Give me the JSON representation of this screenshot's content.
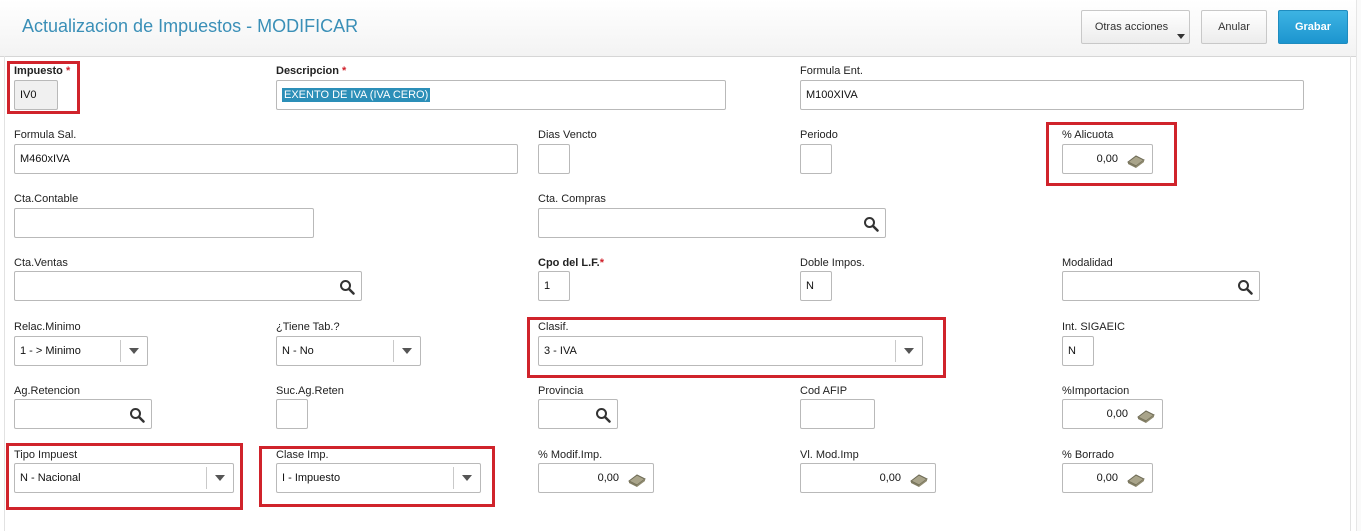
{
  "header": {
    "title": "Actualizacion de Impuestos - MODIFICAR",
    "actions": {
      "otras": "Otras acciones",
      "anular": "Anular",
      "grabar": "Grabar"
    }
  },
  "required_mark": "*",
  "fields": {
    "impuesto": {
      "label": "Impuesto",
      "value": "IV0"
    },
    "descripcion": {
      "label": "Descripcion",
      "value": "EXENTO DE IVA (IVA CERO)"
    },
    "formula_ent": {
      "label": "Formula Ent.",
      "value": "M100XIVA"
    },
    "formula_sal": {
      "label": "Formula Sal.",
      "value": "M460xIVA"
    },
    "dias_vencto": {
      "label": "Dias Vencto",
      "value": ""
    },
    "periodo": {
      "label": "Periodo",
      "value": ""
    },
    "alicuota": {
      "label": "% Alicuota",
      "value": "0,00"
    },
    "cta_contable": {
      "label": "Cta.Contable",
      "value": ""
    },
    "cta_compras": {
      "label": "Cta. Compras",
      "value": ""
    },
    "cta_ventas": {
      "label": "Cta.Ventas",
      "value": ""
    },
    "cpo_lf": {
      "label": "Cpo del L.F.",
      "value": "1"
    },
    "doble_impos": {
      "label": "Doble Impos.",
      "value": "N"
    },
    "modalidad": {
      "label": "Modalidad",
      "value": ""
    },
    "relac_minimo": {
      "label": "Relac.Minimo",
      "value": "1 -  > Minimo"
    },
    "tiene_tab": {
      "label": "¿Tiene Tab.?",
      "value": "N -  No"
    },
    "clasif": {
      "label": "Clasif.",
      "value": "3 - IVA"
    },
    "int_sigaeic": {
      "label": "Int. SIGAEIC",
      "value": "N"
    },
    "ag_retencion": {
      "label": "Ag.Retencion",
      "value": ""
    },
    "suc_ag_reten": {
      "label": "Suc.Ag.Reten",
      "value": ""
    },
    "provincia": {
      "label": "Provincia",
      "value": ""
    },
    "cod_afip": {
      "label": "Cod AFIP",
      "value": ""
    },
    "importacion": {
      "label": "%Importacion",
      "value": "0,00"
    },
    "tipo_impuest": {
      "label": "Tipo Impuest",
      "value": "N - Nacional"
    },
    "clase_imp": {
      "label": "Clase Imp.",
      "value": "I - Impuesto"
    },
    "modif_imp": {
      "label": "% Modif.Imp.",
      "value": "0,00"
    },
    "vl_mod_imp": {
      "label": "Vl. Mod.Imp",
      "value": "0,00"
    },
    "borrado": {
      "label": "% Borrado",
      "value": "0,00"
    }
  },
  "colors": {
    "title": "#3a8fb7",
    "primary_button": "#1c95cf",
    "highlight": "#d0232b",
    "required": "#d0202a"
  }
}
